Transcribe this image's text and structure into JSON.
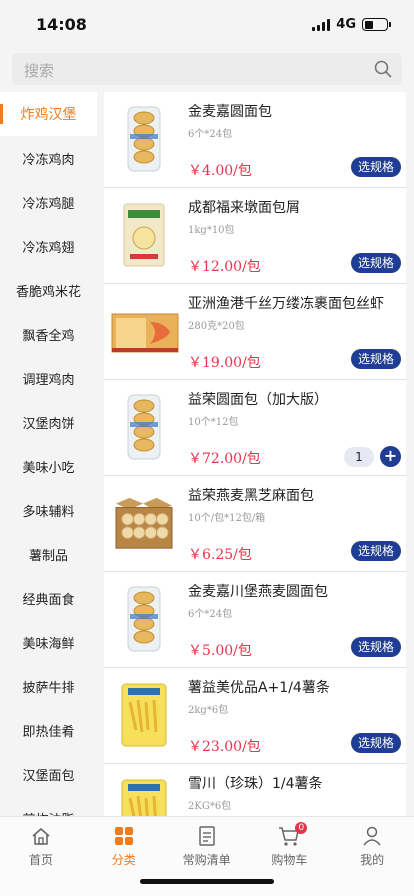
{
  "status": {
    "time": "14:08",
    "network": "4G"
  },
  "search": {
    "placeholder": "搜索"
  },
  "categories": [
    {
      "label": "炸鸡汉堡",
      "active": true
    },
    {
      "label": "冷冻鸡肉"
    },
    {
      "label": "冷冻鸡腿"
    },
    {
      "label": "冷冻鸡翅"
    },
    {
      "label": "香脆鸡米花"
    },
    {
      "label": "飘香全鸡"
    },
    {
      "label": "调理鸡肉"
    },
    {
      "label": "汉堡肉饼"
    },
    {
      "label": "美味小吃"
    },
    {
      "label": "多味辅料"
    },
    {
      "label": "薯制品"
    },
    {
      "label": "经典面食"
    },
    {
      "label": "美味海鲜"
    },
    {
      "label": "披萨牛排"
    },
    {
      "label": "即热佳肴"
    },
    {
      "label": "汉堡面包"
    },
    {
      "label": "煎炸油脂"
    }
  ],
  "products": [
    {
      "name": "金麦嘉圆面包",
      "spec": "6个*24包",
      "price": "￥4.00/包",
      "action": "选规格",
      "thumb": "bun-bag"
    },
    {
      "name": "成都福来墩面包屑",
      "spec": "1kg*10包",
      "price": "￥12.00/包",
      "action": "选规格",
      "thumb": "crumb-bag"
    },
    {
      "name": "亚洲渔港千丝万缕冻裹面包丝虾",
      "spec": "280克*20包",
      "price": "￥19.00/包",
      "action": "选规格",
      "thumb": "shrimp-box"
    },
    {
      "name": "益荣圆面包（加大版）",
      "spec": "10个*12包",
      "price": "￥72.00/包",
      "qty": "1",
      "thumb": "bun-bag"
    },
    {
      "name": "益荣燕麦黑芝麻面包",
      "spec": "10个/包*12包/箱",
      "price": "￥6.25/包",
      "action": "选规格",
      "thumb": "bun-box"
    },
    {
      "name": "金麦嘉川堡燕麦圆面包",
      "spec": "6个*24包",
      "price": "￥5.00/包",
      "action": "选规格",
      "thumb": "bun-bag"
    },
    {
      "name": "薯益美优品A+1/4薯条",
      "spec": "2kg*6包",
      "price": "￥23.00/包",
      "action": "选规格",
      "thumb": "fries-bag"
    },
    {
      "name": "雪川（珍珠）1/4薯条",
      "spec": "2KG*6包",
      "price": "",
      "thumb": "fries-bag"
    }
  ],
  "tabs": [
    {
      "label": "首页",
      "icon": "home-icon"
    },
    {
      "label": "分类",
      "icon": "category-icon",
      "active": true
    },
    {
      "label": "常购清单",
      "icon": "list-icon"
    },
    {
      "label": "购物车",
      "icon": "cart-icon",
      "badge": "0"
    },
    {
      "label": "我的",
      "icon": "user-icon"
    }
  ],
  "colors": {
    "accent": "#f07b1d",
    "button": "#1f3d93",
    "price": "#e8334a"
  }
}
